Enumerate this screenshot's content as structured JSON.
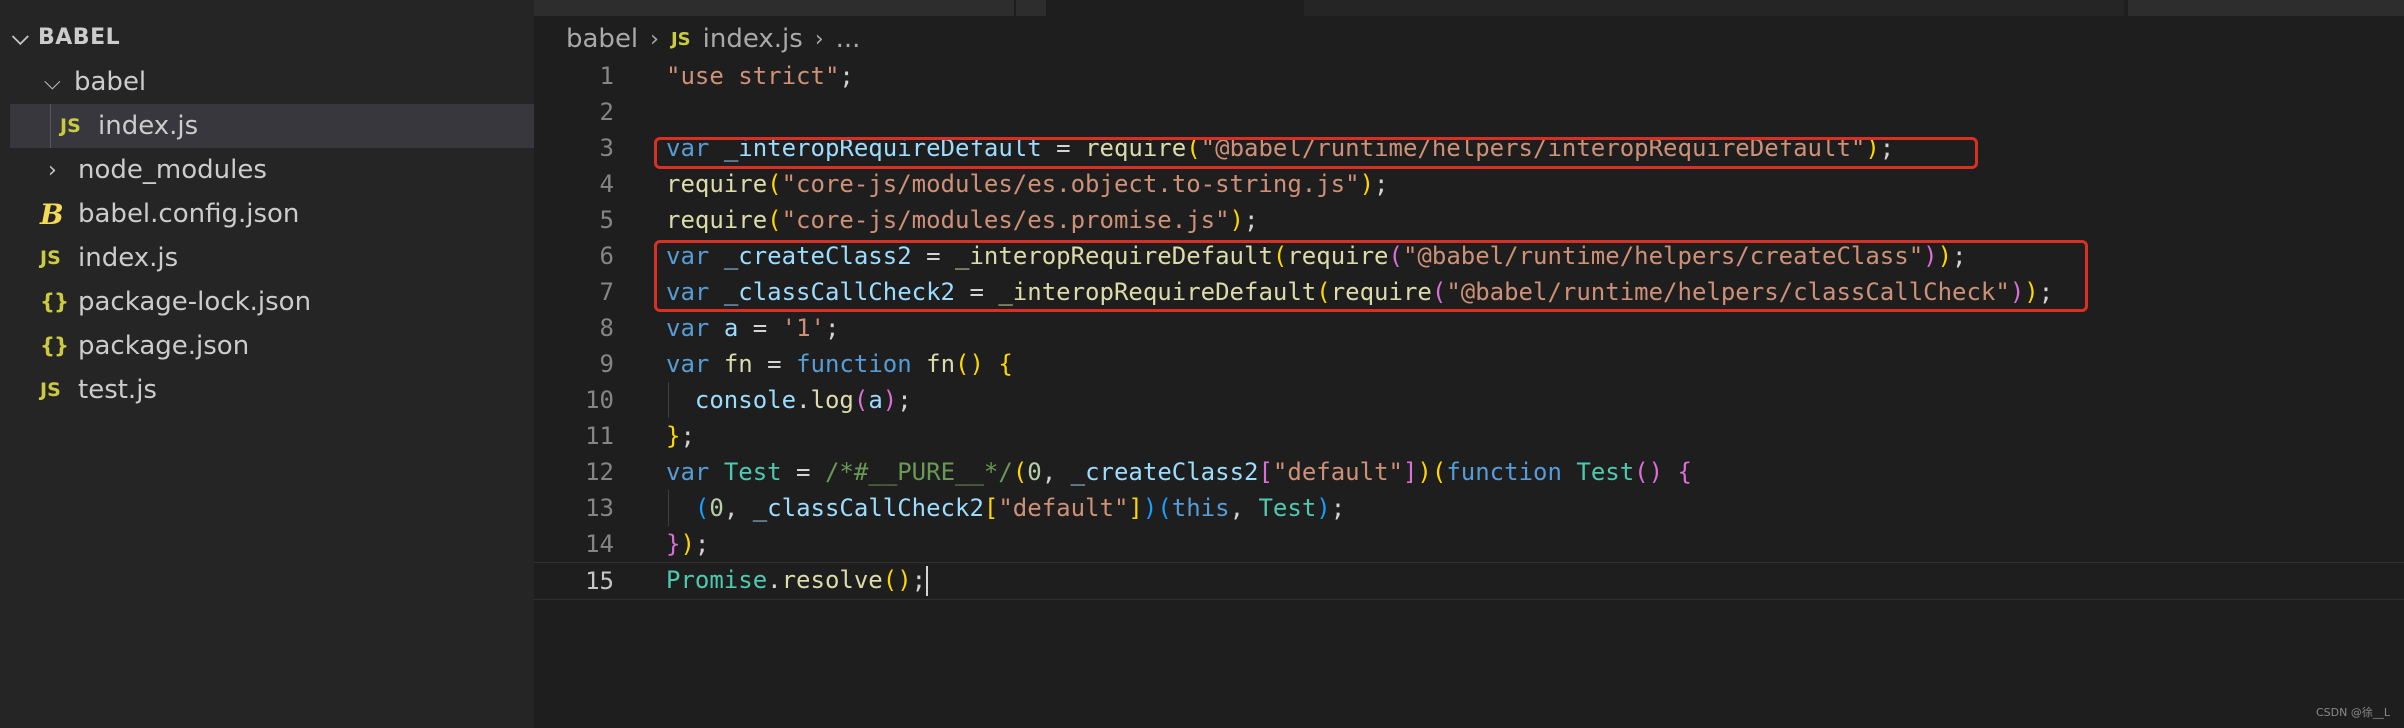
{
  "explorer": {
    "root": "BABEL",
    "items": [
      {
        "label": "babel",
        "type": "folder-open",
        "indent": 1
      },
      {
        "label": "index.js",
        "type": "js",
        "indent": 2,
        "selected": true
      },
      {
        "label": "node_modules",
        "type": "folder-closed",
        "indent": 1
      },
      {
        "label": "babel.config.json",
        "type": "babel",
        "indent": 1
      },
      {
        "label": "index.js",
        "type": "js",
        "indent": 1
      },
      {
        "label": "package-lock.json",
        "type": "json",
        "indent": 1
      },
      {
        "label": "package.json",
        "type": "json",
        "indent": 1
      },
      {
        "label": "test.js",
        "type": "js",
        "indent": 1
      }
    ]
  },
  "breadcrumb": {
    "folder": "babel",
    "file_badge": "JS",
    "file": "index.js",
    "more": "..."
  },
  "editor": {
    "active_line": 15,
    "lines": [
      {
        "n": "1",
        "tokens": [
          [
            "str",
            "\"use strict\""
          ],
          [
            "op",
            ";"
          ]
        ]
      },
      {
        "n": "2",
        "tokens": []
      },
      {
        "n": "3",
        "tokens": [
          [
            "kw",
            "var"
          ],
          [
            "op",
            " "
          ],
          [
            "var",
            "_interopRequireDefault"
          ],
          [
            "op",
            " = "
          ],
          [
            "fn",
            "require"
          ],
          [
            "p1",
            "("
          ],
          [
            "str",
            "\"@babel/runtime/helpers/interopRequireDefault\""
          ],
          [
            "p1",
            ")"
          ],
          [
            "op",
            ";"
          ]
        ]
      },
      {
        "n": "4",
        "tokens": [
          [
            "fn",
            "require"
          ],
          [
            "p1",
            "("
          ],
          [
            "str",
            "\"core-js/modules/es.object.to-string.js\""
          ],
          [
            "p1",
            ")"
          ],
          [
            "op",
            ";"
          ]
        ]
      },
      {
        "n": "5",
        "tokens": [
          [
            "fn",
            "require"
          ],
          [
            "p1",
            "("
          ],
          [
            "str",
            "\"core-js/modules/es.promise.js\""
          ],
          [
            "p1",
            ")"
          ],
          [
            "op",
            ";"
          ]
        ]
      },
      {
        "n": "6",
        "tokens": [
          [
            "kw",
            "var"
          ],
          [
            "op",
            " "
          ],
          [
            "var",
            "_createClass2"
          ],
          [
            "op",
            " = "
          ],
          [
            "fn",
            "_interopRequireDefault"
          ],
          [
            "p1",
            "("
          ],
          [
            "fn",
            "require"
          ],
          [
            "p2",
            "("
          ],
          [
            "str",
            "\"@babel/runtime/helpers/createClass\""
          ],
          [
            "p2",
            ")"
          ],
          [
            "p1",
            ")"
          ],
          [
            "op",
            ";"
          ]
        ]
      },
      {
        "n": "7",
        "tokens": [
          [
            "kw",
            "var"
          ],
          [
            "op",
            " "
          ],
          [
            "var",
            "_classCallCheck2"
          ],
          [
            "op",
            " = "
          ],
          [
            "fn",
            "_interopRequireDefault"
          ],
          [
            "p1",
            "("
          ],
          [
            "fn",
            "require"
          ],
          [
            "p2",
            "("
          ],
          [
            "str",
            "\"@babel/runtime/helpers/classCallCheck\""
          ],
          [
            "p2",
            ")"
          ],
          [
            "p1",
            ")"
          ],
          [
            "op",
            ";"
          ]
        ]
      },
      {
        "n": "8",
        "tokens": [
          [
            "kw",
            "var"
          ],
          [
            "op",
            " "
          ],
          [
            "var",
            "a"
          ],
          [
            "op",
            " = "
          ],
          [
            "str",
            "'1'"
          ],
          [
            "op",
            ";"
          ]
        ]
      },
      {
        "n": "9",
        "tokens": [
          [
            "kw",
            "var"
          ],
          [
            "op",
            " "
          ],
          [
            "fn",
            "fn"
          ],
          [
            "op",
            " = "
          ],
          [
            "kw",
            "function"
          ],
          [
            "op",
            " "
          ],
          [
            "fn",
            "fn"
          ],
          [
            "p1",
            "()"
          ],
          [
            "op",
            " "
          ],
          [
            "p1",
            "{"
          ]
        ]
      },
      {
        "n": "10",
        "indent": true,
        "tokens": [
          [
            "op",
            "  "
          ],
          [
            "var",
            "console"
          ],
          [
            "op",
            "."
          ],
          [
            "fn",
            "log"
          ],
          [
            "p2",
            "("
          ],
          [
            "var",
            "a"
          ],
          [
            "p2",
            ")"
          ],
          [
            "op",
            ";"
          ]
        ]
      },
      {
        "n": "11",
        "tokens": [
          [
            "p1",
            "}"
          ],
          [
            "op",
            ";"
          ]
        ]
      },
      {
        "n": "12",
        "tokens": [
          [
            "kw",
            "var"
          ],
          [
            "op",
            " "
          ],
          [
            "type",
            "Test"
          ],
          [
            "op",
            " = "
          ],
          [
            "cm",
            "/*#__PURE__*/"
          ],
          [
            "p1",
            "("
          ],
          [
            "num",
            "0"
          ],
          [
            "op",
            ", "
          ],
          [
            "var",
            "_createClass2"
          ],
          [
            "p2",
            "["
          ],
          [
            "str",
            "\"default\""
          ],
          [
            "p2",
            "]"
          ],
          [
            "p1",
            ")"
          ],
          [
            "p1",
            "("
          ],
          [
            "kw",
            "function"
          ],
          [
            "op",
            " "
          ],
          [
            "type",
            "Test"
          ],
          [
            "p2",
            "()"
          ],
          [
            "op",
            " "
          ],
          [
            "p2",
            "{"
          ]
        ]
      },
      {
        "n": "13",
        "indent": true,
        "tokens": [
          [
            "op",
            "  "
          ],
          [
            "p3",
            "("
          ],
          [
            "num",
            "0"
          ],
          [
            "op",
            ", "
          ],
          [
            "var",
            "_classCallCheck2"
          ],
          [
            "p1",
            "["
          ],
          [
            "str",
            "\"default\""
          ],
          [
            "p1",
            "]"
          ],
          [
            "p3",
            ")"
          ],
          [
            "p3",
            "("
          ],
          [
            "kw",
            "this"
          ],
          [
            "op",
            ", "
          ],
          [
            "type",
            "Test"
          ],
          [
            "p3",
            ")"
          ],
          [
            "op",
            ";"
          ]
        ]
      },
      {
        "n": "14",
        "tokens": [
          [
            "p2",
            "}"
          ],
          [
            "p1",
            ")"
          ],
          [
            "op",
            ";"
          ]
        ]
      },
      {
        "n": "15",
        "tokens": [
          [
            "type",
            "Promise"
          ],
          [
            "op",
            "."
          ],
          [
            "fn",
            "resolve"
          ],
          [
            "p1",
            "()"
          ],
          [
            "op",
            ";"
          ]
        ]
      }
    ]
  },
  "watermark": "CSDN @徐__L",
  "colors": {
    "highlight_box": "#d93025",
    "sidebar_bg": "#252526",
    "editor_bg": "#1e1e1e",
    "selected_row": "#37373d"
  }
}
